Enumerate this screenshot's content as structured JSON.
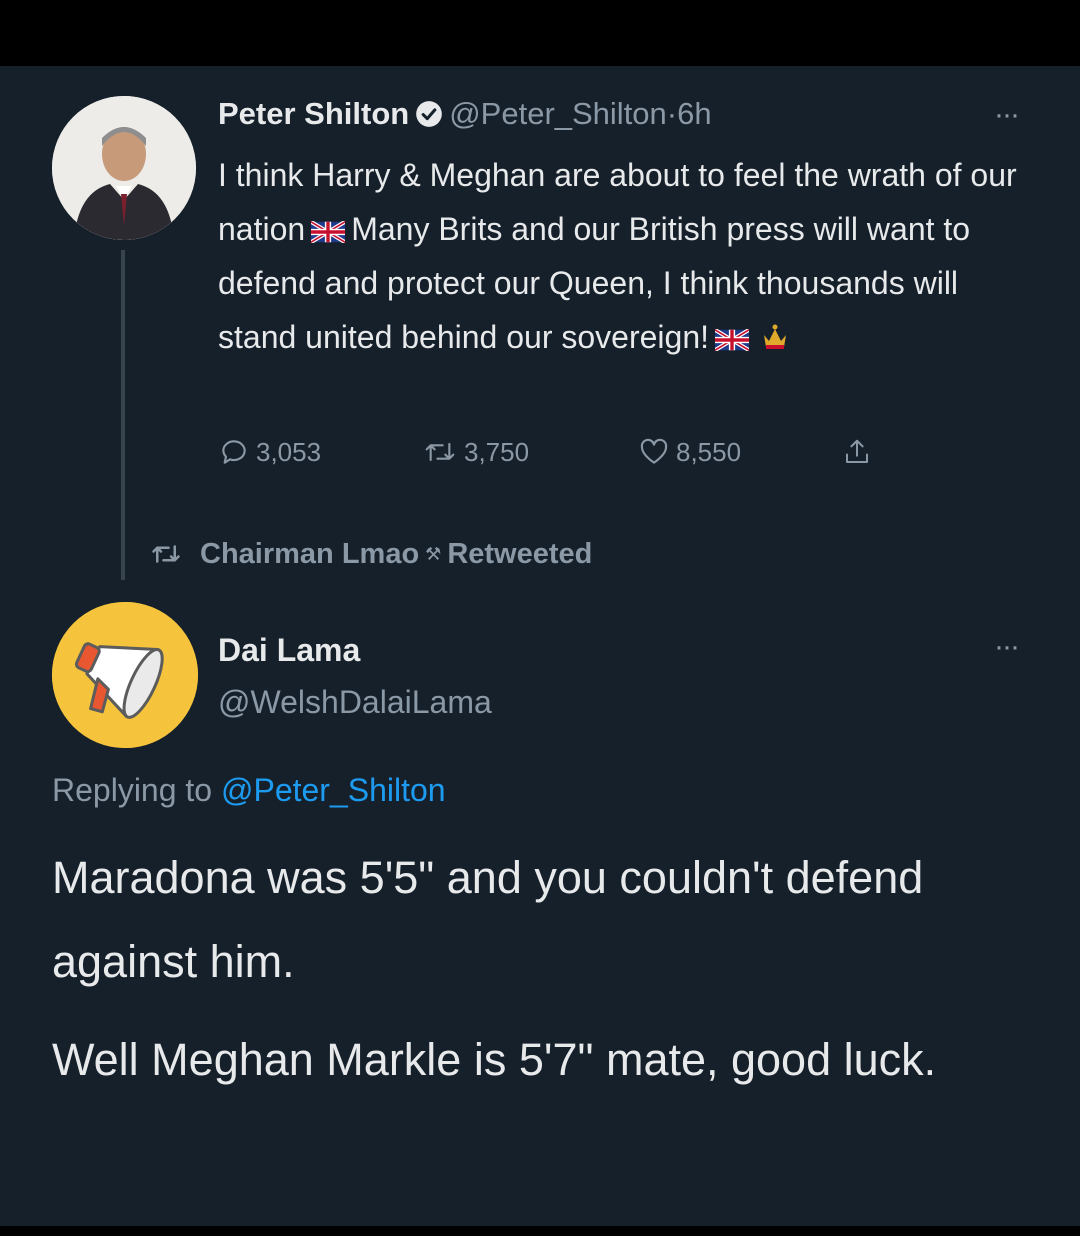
{
  "tweet1": {
    "author_name": "Peter Shilton",
    "handle": "@Peter_Shilton",
    "separator": "·",
    "time": "6h",
    "more": "···",
    "text_part1": "I think Harry & Meghan are about to feel the wrath of our nation",
    "text_part2": "Many Brits and our British press will want to defend and protect our Queen,  I think thousands will stand united behind our sovereign!",
    "emoji_flag": "union-jack-flag-icon",
    "emoji_crown": "crown-icon",
    "replies": "3,053",
    "retweets": "3,750",
    "likes": "8,550"
  },
  "retweet_bar": {
    "user": "Chairman Lmao",
    "suffix": "Retweeted",
    "emoji": "⚒"
  },
  "tweet2": {
    "author_name": "Dai Lama",
    "handle": "@WelshDalaiLama",
    "more": "···",
    "replying_prefix": "Replying to",
    "replying_to": "@Peter_Shilton",
    "paragraph1": "Maradona was 5'5\" and you couldn't defend against him.",
    "paragraph2": "Well Meghan Markle is 5'7\" mate, good luck."
  },
  "colors": {
    "background": "#15202b",
    "primary_text": "#e7e9ea",
    "secondary_text": "#8b98a5",
    "accent": "#1d9bf0",
    "thread_line": "#38444d"
  }
}
